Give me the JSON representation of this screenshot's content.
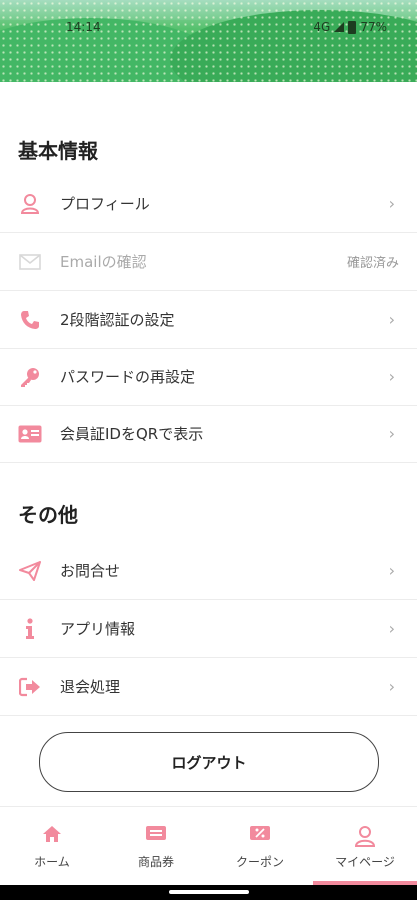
{
  "status_bar": {
    "time": "14:14",
    "network": "4G",
    "battery": "77%"
  },
  "basic_info": {
    "title": "基本情報",
    "items": [
      {
        "label": "プロフィール",
        "icon": "person-icon",
        "status": ""
      },
      {
        "label": "Emailの確認",
        "icon": "mail-icon",
        "status": "確認済み"
      },
      {
        "label": "2段階認証の設定",
        "icon": "phone-icon",
        "status": ""
      },
      {
        "label": "パスワードの再設定",
        "icon": "key-icon",
        "status": ""
      },
      {
        "label": "会員証IDをQRで表示",
        "icon": "id-card-icon",
        "status": ""
      }
    ]
  },
  "other": {
    "title": "その他",
    "items": [
      {
        "label": "お問合せ",
        "icon": "paper-plane-icon"
      },
      {
        "label": "アプリ情報",
        "icon": "info-icon"
      },
      {
        "label": "退会処理",
        "icon": "sign-out-icon"
      }
    ]
  },
  "logout_label": "ログアウト",
  "tabs": [
    {
      "label": "ホーム",
      "icon": "home-icon"
    },
    {
      "label": "商品券",
      "icon": "ticket-icon"
    },
    {
      "label": "クーポン",
      "icon": "coupon-icon"
    },
    {
      "label": "マイページ",
      "icon": "user-icon",
      "active": true
    }
  ],
  "colors": {
    "accent": "#f28a9d",
    "muted_icon": "#d8d8d8",
    "text": "#333333"
  },
  "chevron": "›"
}
